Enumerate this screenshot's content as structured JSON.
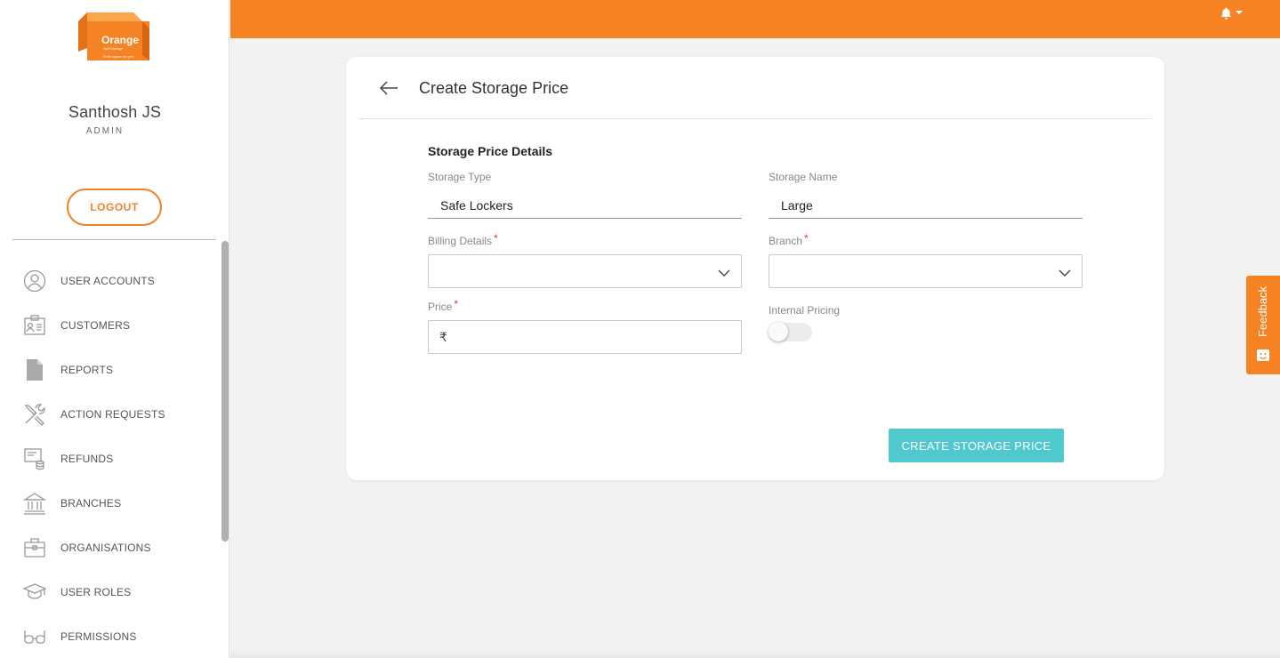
{
  "logo": {
    "brand": "Orange",
    "sub": "Self Storage",
    "tagline": "Extra space for you",
    "color": "#f58323"
  },
  "user": {
    "name": "Santhosh JS",
    "role": "ADMIN"
  },
  "sidebar": {
    "logout_label": "LOGOUT",
    "items": [
      {
        "label": "USER ACCOUNTS",
        "icon": "user-circle-icon"
      },
      {
        "label": "CUSTOMERS",
        "icon": "id-card-icon"
      },
      {
        "label": "REPORTS",
        "icon": "document-icon"
      },
      {
        "label": "ACTION REQUESTS",
        "icon": "tools-icon"
      },
      {
        "label": "REFUNDS",
        "icon": "refund-icon"
      },
      {
        "label": "BRANCHES",
        "icon": "bank-icon"
      },
      {
        "label": "ORGANISATIONS",
        "icon": "briefcase-icon"
      },
      {
        "label": "USER ROLES",
        "icon": "graduation-cap-icon"
      },
      {
        "label": "PERMISSIONS",
        "icon": "glasses-icon"
      }
    ]
  },
  "topbar": {
    "color": "#f58323",
    "icons": [
      "bell-icon",
      "caret-down-icon"
    ]
  },
  "form": {
    "title": "Create Storage Price",
    "section_title": "Storage Price Details",
    "storage_type": {
      "label": "Storage Type",
      "value": "Safe Lockers"
    },
    "storage_name": {
      "label": "Storage Name",
      "value": "Large"
    },
    "billing_details": {
      "label": "Billing Details",
      "required": "*",
      "value": ""
    },
    "branch": {
      "label": "Branch",
      "required": "*",
      "value": ""
    },
    "price": {
      "label": "Price",
      "required": "*",
      "currency": "₹",
      "value": ""
    },
    "internal_pricing": {
      "label": "Internal Pricing",
      "enabled": false
    },
    "submit_label": "CREATE STORAGE PRICE",
    "accent": "#4fc9cd"
  },
  "feedback": {
    "label": "Feedback"
  }
}
